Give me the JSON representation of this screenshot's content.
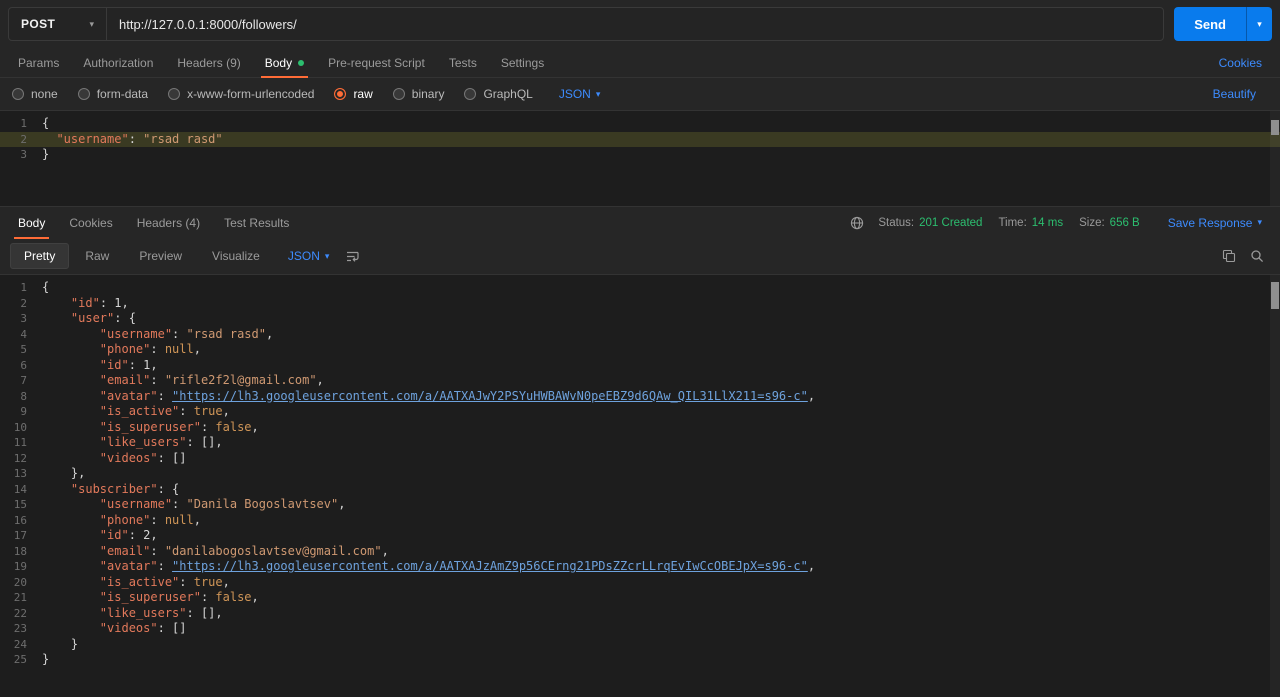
{
  "colors": {
    "accent": "#ff6c37",
    "link": "#3d8bfd",
    "success": "#2cbe6f",
    "send-bg": "#097bed",
    "chrome-bg": "#262626",
    "editor-bg": "#1d1d1d",
    "border": "#333333",
    "tab-inactive": "#9b9b9b",
    "tok-key": "#e2795b",
    "tok-string": "#cf9972",
    "tok-number": "#d6d6d6",
    "tok-bool": "#cf9557",
    "tok-link": "#6ea2dd",
    "tok-punc": "#d4d4d4",
    "line-number": "#6e6e6e",
    "highlight-line": "#3a3a22"
  },
  "request": {
    "method": "POST",
    "url": "http://127.0.0.1:8000/followers/",
    "send_label": "Send",
    "tabs": [
      {
        "label": "Params"
      },
      {
        "label": "Authorization"
      },
      {
        "label": "Headers (9)"
      },
      {
        "label": "Body"
      },
      {
        "label": "Pre-request Script"
      },
      {
        "label": "Tests"
      },
      {
        "label": "Settings"
      }
    ],
    "cookies_link": "Cookies",
    "body_modes": [
      {
        "label": "none"
      },
      {
        "label": "form-data"
      },
      {
        "label": "x-www-form-urlencoded"
      },
      {
        "label": "raw"
      },
      {
        "label": "binary"
      },
      {
        "label": "GraphQL"
      }
    ],
    "raw_language": "JSON",
    "beautify_link": "Beautify",
    "editor": {
      "highlight_line": 2,
      "lines": [
        [
          [
            "p",
            "{"
          ]
        ],
        [
          [
            "p",
            "  "
          ],
          [
            "k",
            "\"username\""
          ],
          [
            "p",
            ": "
          ],
          [
            "s",
            "\"rsad rasd\""
          ]
        ],
        [
          [
            "p",
            "}"
          ]
        ]
      ]
    }
  },
  "response": {
    "tabs": [
      {
        "label": "Body"
      },
      {
        "label": "Cookies"
      },
      {
        "label": "Headers (4)"
      },
      {
        "label": "Test Results"
      }
    ],
    "meta": {
      "status_label": "Status:",
      "status_value": "201 Created",
      "time_label": "Time:",
      "time_value": "14 ms",
      "size_label": "Size:",
      "size_value": "656 B",
      "save_label": "Save Response"
    },
    "views": [
      {
        "label": "Pretty"
      },
      {
        "label": "Raw"
      },
      {
        "label": "Preview"
      },
      {
        "label": "Visualize"
      }
    ],
    "raw_language": "JSON",
    "editor": {
      "lines": [
        [
          [
            "p",
            "{"
          ]
        ],
        [
          [
            "p",
            "    "
          ],
          [
            "k",
            "\"id\""
          ],
          [
            "p",
            ": "
          ],
          [
            "n",
            "1"
          ],
          [
            "p",
            ","
          ]
        ],
        [
          [
            "p",
            "    "
          ],
          [
            "k",
            "\"user\""
          ],
          [
            "p",
            ": {"
          ]
        ],
        [
          [
            "p",
            "        "
          ],
          [
            "k",
            "\"username\""
          ],
          [
            "p",
            ": "
          ],
          [
            "s",
            "\"rsad rasd\""
          ],
          [
            "p",
            ","
          ]
        ],
        [
          [
            "p",
            "        "
          ],
          [
            "k",
            "\"phone\""
          ],
          [
            "p",
            ": "
          ],
          [
            "u",
            "null"
          ],
          [
            "p",
            ","
          ]
        ],
        [
          [
            "p",
            "        "
          ],
          [
            "k",
            "\"id\""
          ],
          [
            "p",
            ": "
          ],
          [
            "n",
            "1"
          ],
          [
            "p",
            ","
          ]
        ],
        [
          [
            "p",
            "        "
          ],
          [
            "k",
            "\"email\""
          ],
          [
            "p",
            ": "
          ],
          [
            "s",
            "\"rifle2f2l@gmail.com\""
          ],
          [
            "p",
            ","
          ]
        ],
        [
          [
            "p",
            "        "
          ],
          [
            "k",
            "\"avatar\""
          ],
          [
            "p",
            ": "
          ],
          [
            "l",
            "\"https://lh3.googleusercontent.com/a/AATXAJwY2PSYuHWBAWvN0peEBZ9d6QAw_QIL31LlX211=s96-c\""
          ],
          [
            "p",
            ","
          ]
        ],
        [
          [
            "p",
            "        "
          ],
          [
            "k",
            "\"is_active\""
          ],
          [
            "p",
            ": "
          ],
          [
            "b",
            "true"
          ],
          [
            "p",
            ","
          ]
        ],
        [
          [
            "p",
            "        "
          ],
          [
            "k",
            "\"is_superuser\""
          ],
          [
            "p",
            ": "
          ],
          [
            "b",
            "false"
          ],
          [
            "p",
            ","
          ]
        ],
        [
          [
            "p",
            "        "
          ],
          [
            "k",
            "\"like_users\""
          ],
          [
            "p",
            ": [],"
          ]
        ],
        [
          [
            "p",
            "        "
          ],
          [
            "k",
            "\"videos\""
          ],
          [
            "p",
            ": []"
          ]
        ],
        [
          [
            "p",
            "    },"
          ]
        ],
        [
          [
            "p",
            "    "
          ],
          [
            "k",
            "\"subscriber\""
          ],
          [
            "p",
            ": {"
          ]
        ],
        [
          [
            "p",
            "        "
          ],
          [
            "k",
            "\"username\""
          ],
          [
            "p",
            ": "
          ],
          [
            "s",
            "\"Danila Bogoslavtsev\""
          ],
          [
            "p",
            ","
          ]
        ],
        [
          [
            "p",
            "        "
          ],
          [
            "k",
            "\"phone\""
          ],
          [
            "p",
            ": "
          ],
          [
            "u",
            "null"
          ],
          [
            "p",
            ","
          ]
        ],
        [
          [
            "p",
            "        "
          ],
          [
            "k",
            "\"id\""
          ],
          [
            "p",
            ": "
          ],
          [
            "n",
            "2"
          ],
          [
            "p",
            ","
          ]
        ],
        [
          [
            "p",
            "        "
          ],
          [
            "k",
            "\"email\""
          ],
          [
            "p",
            ": "
          ],
          [
            "s",
            "\"danilabogoslavtsev@gmail.com\""
          ],
          [
            "p",
            ","
          ]
        ],
        [
          [
            "p",
            "        "
          ],
          [
            "k",
            "\"avatar\""
          ],
          [
            "p",
            ": "
          ],
          [
            "l",
            "\"https://lh3.googleusercontent.com/a/AATXAJzAmZ9p56CErng21PDsZZcrLLrqEvIwCcOBEJpX=s96-c\""
          ],
          [
            "p",
            ","
          ]
        ],
        [
          [
            "p",
            "        "
          ],
          [
            "k",
            "\"is_active\""
          ],
          [
            "p",
            ": "
          ],
          [
            "b",
            "true"
          ],
          [
            "p",
            ","
          ]
        ],
        [
          [
            "p",
            "        "
          ],
          [
            "k",
            "\"is_superuser\""
          ],
          [
            "p",
            ": "
          ],
          [
            "b",
            "false"
          ],
          [
            "p",
            ","
          ]
        ],
        [
          [
            "p",
            "        "
          ],
          [
            "k",
            "\"like_users\""
          ],
          [
            "p",
            ": [],"
          ]
        ],
        [
          [
            "p",
            "        "
          ],
          [
            "k",
            "\"videos\""
          ],
          [
            "p",
            ": []"
          ]
        ],
        [
          [
            "p",
            "    }"
          ]
        ],
        [
          [
            "p",
            "}"
          ]
        ]
      ]
    }
  }
}
